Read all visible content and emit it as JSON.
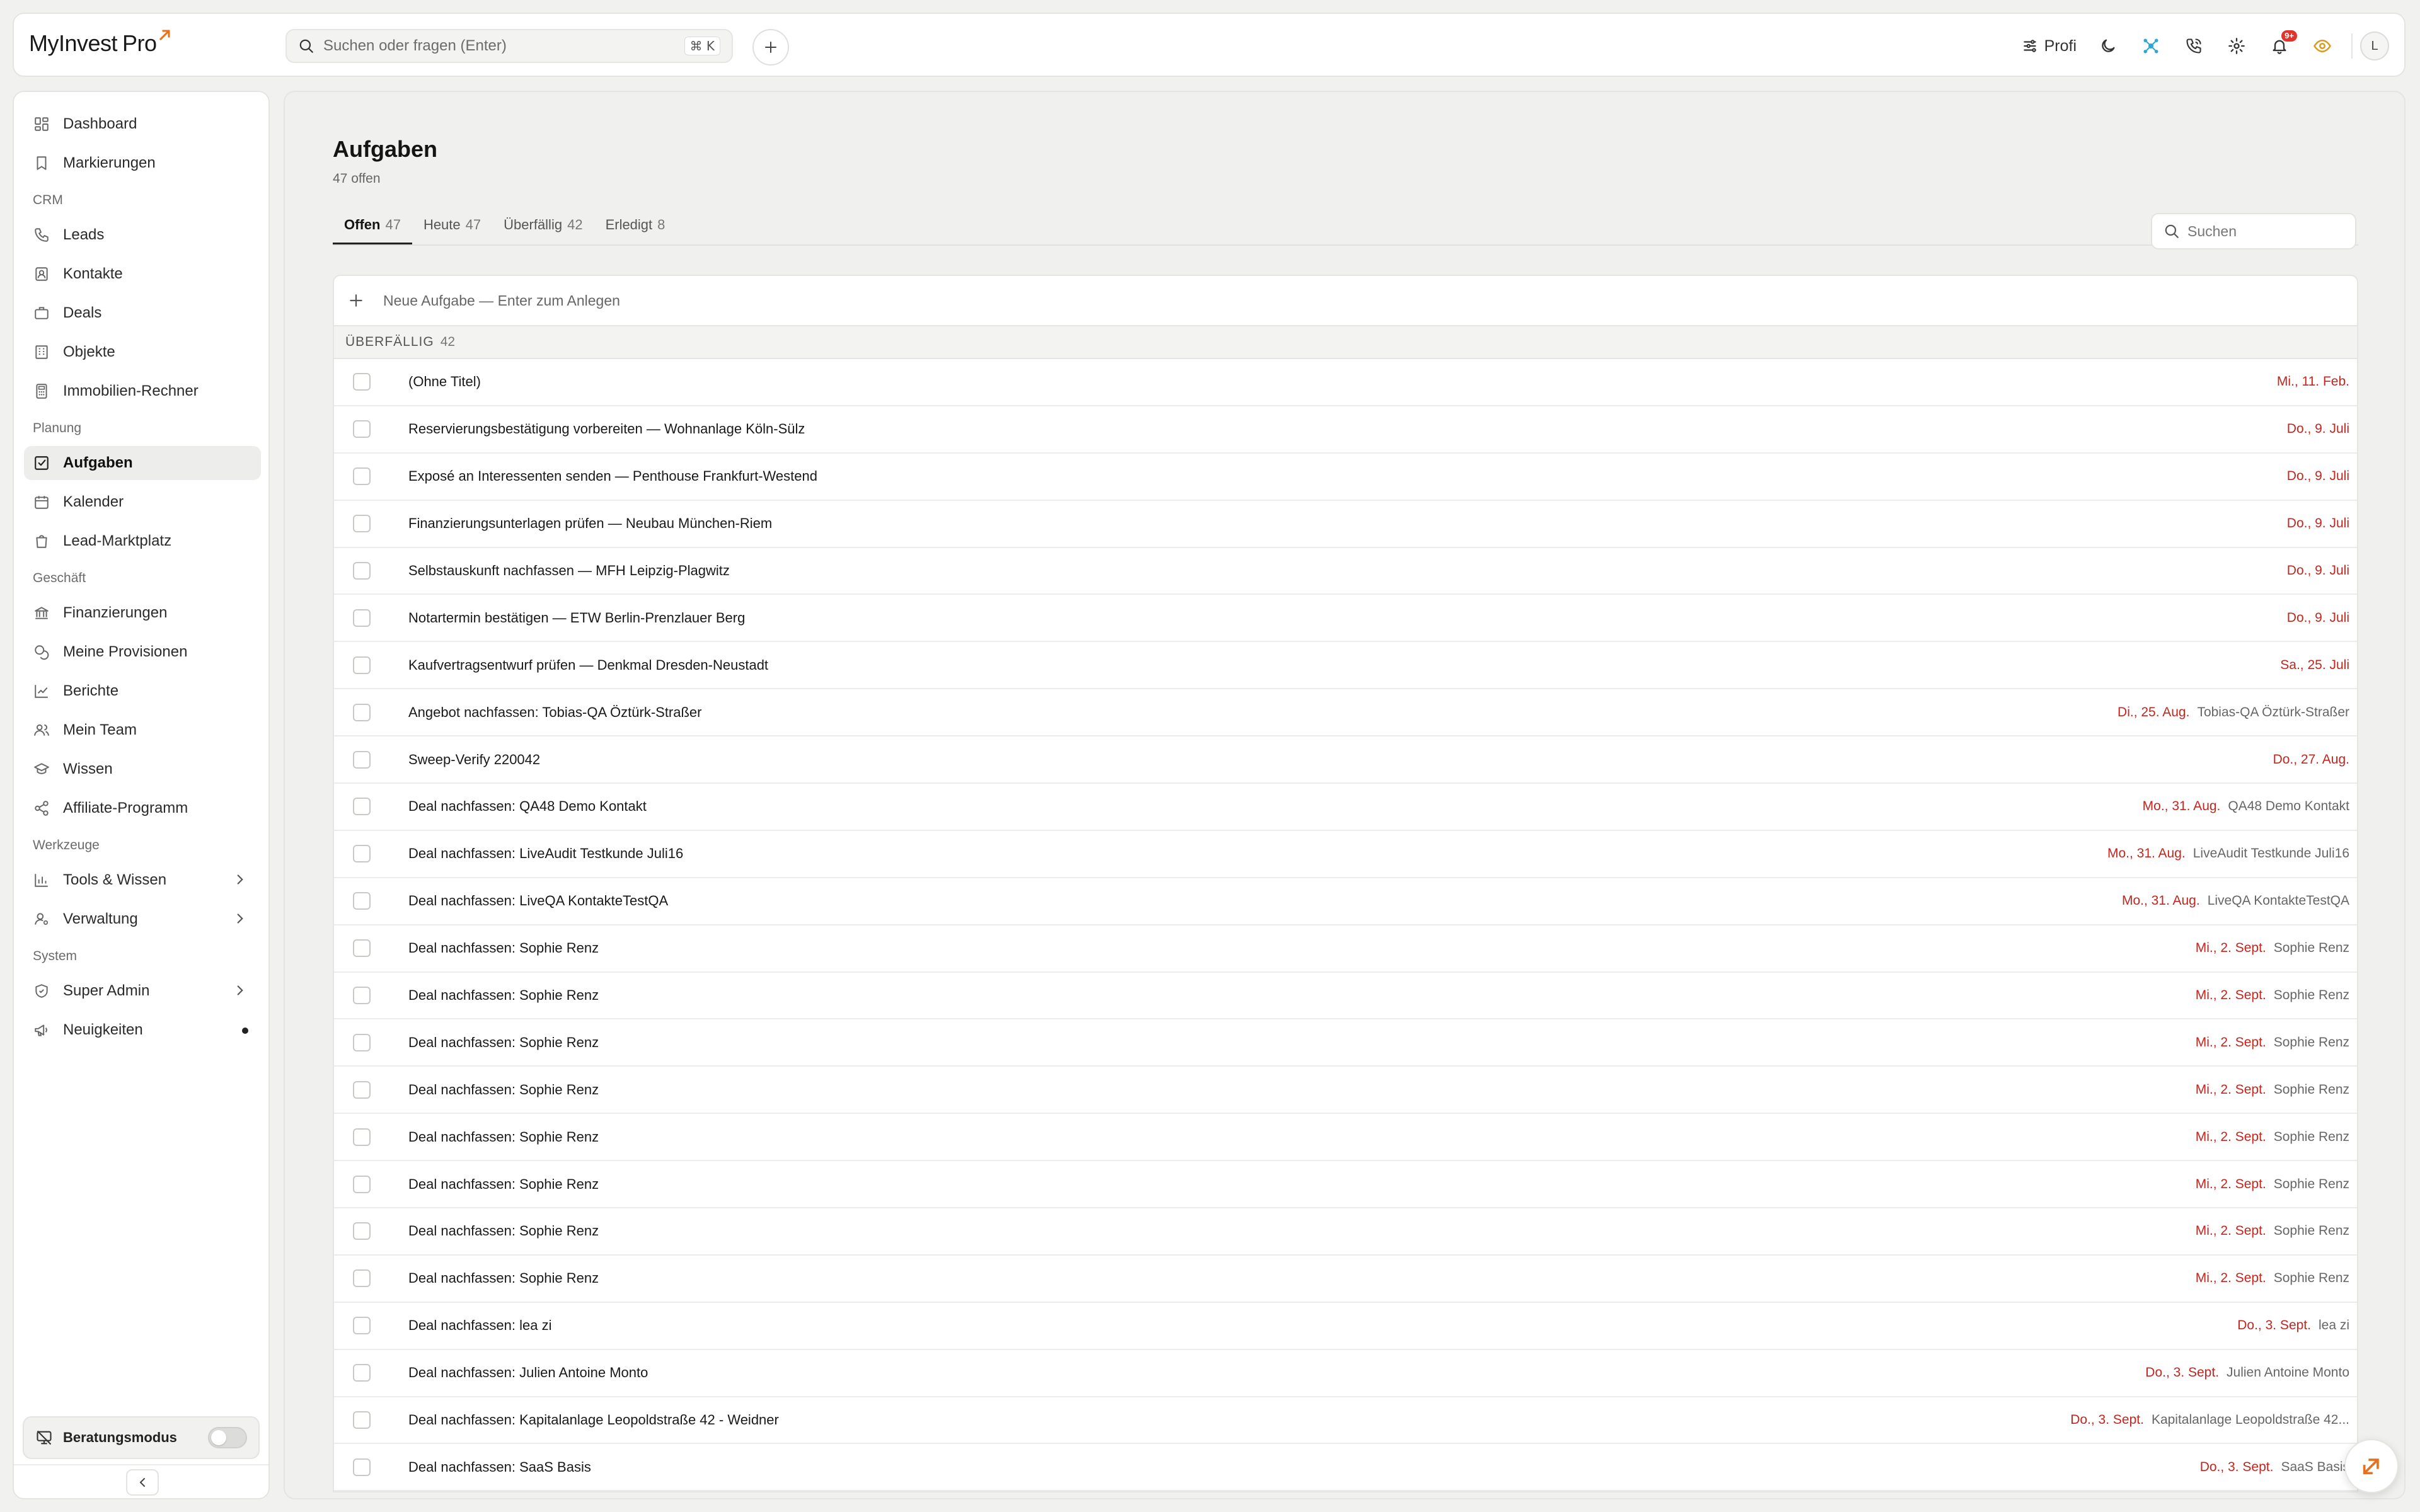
{
  "brand": {
    "name": "MyInvest",
    "suffix": "Pro",
    "accent": "#e8701a"
  },
  "search": {
    "placeholder": "Suchen oder fragen (Enter)",
    "shortcut": "⌘ K"
  },
  "topbar": {
    "profi_label": "Profi",
    "notifications_badge": "9+",
    "avatar_initial": "L"
  },
  "sidebar": {
    "main": [
      {
        "label": "Dashboard",
        "icon": "dashboard-icon"
      },
      {
        "label": "Markierungen",
        "icon": "bookmark-icon"
      }
    ],
    "crm_label": "CRM",
    "crm": [
      {
        "label": "Leads",
        "icon": "phone-icon"
      },
      {
        "label": "Kontakte",
        "icon": "contact-icon"
      },
      {
        "label": "Deals",
        "icon": "briefcase-icon"
      },
      {
        "label": "Objekte",
        "icon": "building-icon"
      },
      {
        "label": "Immobilien-Rechner",
        "icon": "calculator-icon"
      }
    ],
    "planung_label": "Planung",
    "planung": [
      {
        "label": "Aufgaben",
        "icon": "checkbox-icon",
        "active": true
      },
      {
        "label": "Kalender",
        "icon": "calendar-icon"
      },
      {
        "label": "Lead-Marktplatz",
        "icon": "shopping-bag-icon"
      }
    ],
    "geschaeft_label": "Geschäft",
    "geschaeft": [
      {
        "label": "Finanzierungen",
        "icon": "bank-icon"
      },
      {
        "label": "Meine Provisionen",
        "icon": "coins-icon"
      },
      {
        "label": "Berichte",
        "icon": "line-chart-icon"
      },
      {
        "label": "Mein Team",
        "icon": "team-icon"
      },
      {
        "label": "Wissen",
        "icon": "graduation-cap-icon"
      },
      {
        "label": "Affiliate-Programm",
        "icon": "share-icon"
      }
    ],
    "werkzeuge_label": "Werkzeuge",
    "werkzeuge": [
      {
        "label": "Tools & Wissen",
        "icon": "bar-chart-icon"
      },
      {
        "label": "Verwaltung",
        "icon": "user-cog-icon"
      }
    ],
    "system_label": "System",
    "system": [
      {
        "label": "Super Admin",
        "icon": "shield-icon"
      },
      {
        "label": "Neuigkeiten",
        "icon": "megaphone-icon"
      }
    ],
    "consult_label": "Beratungsmodus"
  },
  "page": {
    "title": "Aufgaben",
    "subtitle": "47 offen",
    "tabs": [
      {
        "label": "Offen",
        "count": "47",
        "active": true
      },
      {
        "label": "Heute",
        "count": "47"
      },
      {
        "label": "Überfällig",
        "count": "42"
      },
      {
        "label": "Erledigt",
        "count": "8"
      }
    ],
    "search_placeholder": "Suchen",
    "new_task_placeholder": "Neue Aufgabe — Enter zum Anlegen",
    "group_label": "ÜBERFÄLLIG",
    "group_count": "42"
  },
  "tasks": [
    {
      "title": "(Ohne Titel)",
      "date": "Mi., 11. Feb.",
      "contact": ""
    },
    {
      "title": "Reservierungsbestätigung vorbereiten — Wohnanlage Köln-Sülz",
      "date": "Do., 9. Juli",
      "contact": ""
    },
    {
      "title": "Exposé an Interessenten senden — Penthouse Frankfurt-Westend",
      "date": "Do., 9. Juli",
      "contact": ""
    },
    {
      "title": "Finanzierungsunterlagen prüfen — Neubau München-Riem",
      "date": "Do., 9. Juli",
      "contact": ""
    },
    {
      "title": "Selbstauskunft nachfassen — MFH Leipzig-Plagwitz",
      "date": "Do., 9. Juli",
      "contact": ""
    },
    {
      "title": "Notartermin bestätigen — ETW Berlin-Prenzlauer Berg",
      "date": "Do., 9. Juli",
      "contact": ""
    },
    {
      "title": "Kaufvertragsentwurf prüfen — Denkmal Dresden-Neustadt",
      "date": "Sa., 25. Juli",
      "contact": ""
    },
    {
      "title": "Angebot nachfassen: Tobias-QA Öztürk-Straßer",
      "date": "Di., 25. Aug.",
      "contact": "Tobias-QA Öztürk-Straßer"
    },
    {
      "title": "Sweep-Verify 220042",
      "date": "Do., 27. Aug.",
      "contact": ""
    },
    {
      "title": "Deal nachfassen: QA48 Demo Kontakt",
      "date": "Mo., 31. Aug.",
      "contact": "QA48 Demo Kontakt"
    },
    {
      "title": "Deal nachfassen: LiveAudit Testkunde Juli16",
      "date": "Mo., 31. Aug.",
      "contact": "LiveAudit Testkunde Juli16"
    },
    {
      "title": "Deal nachfassen: LiveQA KontakteTestQA",
      "date": "Mo., 31. Aug.",
      "contact": "LiveQA KontakteTestQA"
    },
    {
      "title": "Deal nachfassen: Sophie Renz",
      "date": "Mi., 2. Sept.",
      "contact": "Sophie Renz"
    },
    {
      "title": "Deal nachfassen: Sophie Renz",
      "date": "Mi., 2. Sept.",
      "contact": "Sophie Renz"
    },
    {
      "title": "Deal nachfassen: Sophie Renz",
      "date": "Mi., 2. Sept.",
      "contact": "Sophie Renz"
    },
    {
      "title": "Deal nachfassen: Sophie Renz",
      "date": "Mi., 2. Sept.",
      "contact": "Sophie Renz"
    },
    {
      "title": "Deal nachfassen: Sophie Renz",
      "date": "Mi., 2. Sept.",
      "contact": "Sophie Renz"
    },
    {
      "title": "Deal nachfassen: Sophie Renz",
      "date": "Mi., 2. Sept.",
      "contact": "Sophie Renz"
    },
    {
      "title": "Deal nachfassen: Sophie Renz",
      "date": "Mi., 2. Sept.",
      "contact": "Sophie Renz"
    },
    {
      "title": "Deal nachfassen: Sophie Renz",
      "date": "Mi., 2. Sept.",
      "contact": "Sophie Renz"
    },
    {
      "title": "Deal nachfassen: lea zi",
      "date": "Do., 3. Sept.",
      "contact": "lea zi"
    },
    {
      "title": "Deal nachfassen: Julien Antoine Monto",
      "date": "Do., 3. Sept.",
      "contact": "Julien Antoine Monto"
    },
    {
      "title": "Deal nachfassen: Kapitalanlage Leopoldstraße 42 - Weidner",
      "date": "Do., 3. Sept.",
      "contact": "Kapitalanlage Leopoldstraße 42..."
    },
    {
      "title": "Deal nachfassen: SaaS Basis",
      "date": "Do., 3. Sept.",
      "contact": "SaaS Basis"
    }
  ],
  "colors": {
    "overdue": "#c2261f",
    "active_nav": "#ededeb"
  }
}
